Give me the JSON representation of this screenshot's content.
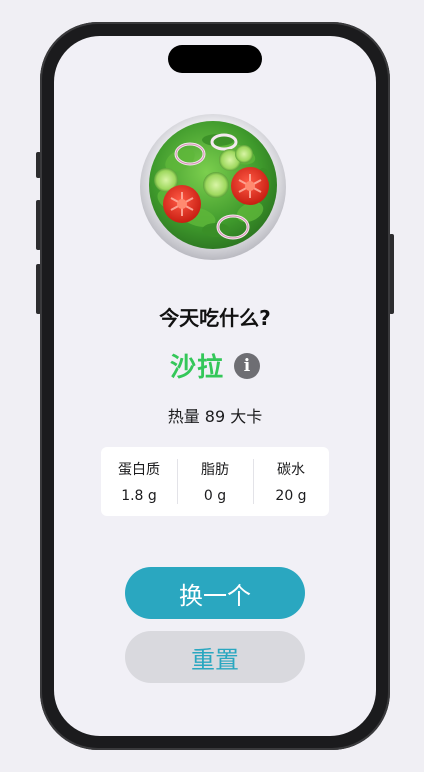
{
  "screen": {
    "question": "今天吃什么?",
    "dish": {
      "name": "沙拉",
      "image_icon": "salad-emoji",
      "info_icon": "info-circle-icon"
    },
    "calorie_text": "热量 89 大卡",
    "nutrition": [
      {
        "label": "蛋白质",
        "value": "1.8 g"
      },
      {
        "label": "脂肪",
        "value": "0 g"
      },
      {
        "label": "碳水",
        "value": "20 g"
      }
    ],
    "buttons": {
      "shuffle_label": "换一个",
      "reset_label": "重置"
    }
  },
  "colors": {
    "accent_green": "#34c759",
    "accent_teal": "#2aa7c0",
    "secondary_button_bg": "#d9d9de",
    "background": "#f1f0f6"
  }
}
